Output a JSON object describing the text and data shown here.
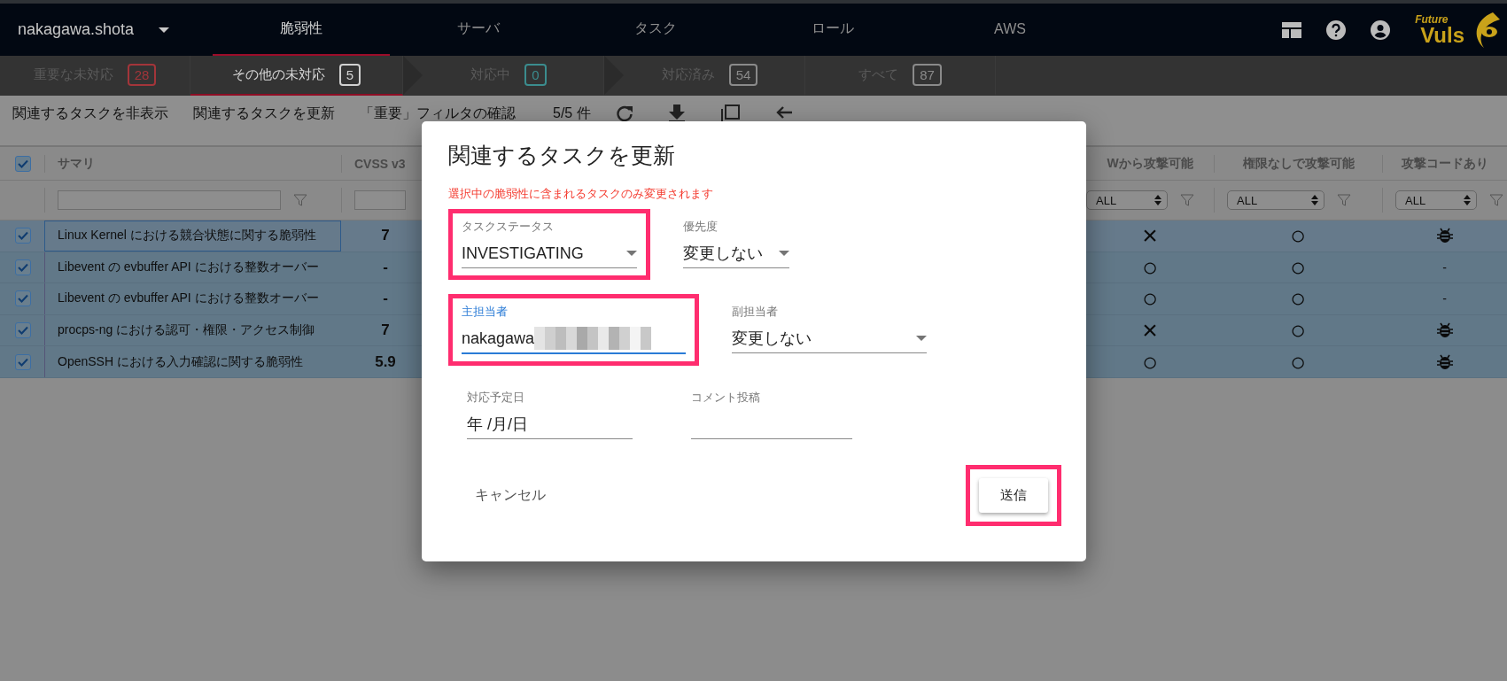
{
  "nav": {
    "user": "nakagawa.shota",
    "tabs": [
      {
        "label": "脆弱性",
        "selected": true
      },
      {
        "label": "サーバ",
        "selected": false
      },
      {
        "label": "タスク",
        "selected": false
      },
      {
        "label": "ロール",
        "selected": false
      },
      {
        "label": "AWS",
        "selected": false
      }
    ],
    "logo": {
      "line_1": "Future",
      "line_2": "Vuls"
    }
  },
  "status_tabs": [
    {
      "label": "重要な未対応",
      "count": "28",
      "color": "#a3353a",
      "selected": false,
      "arrow_after": false
    },
    {
      "label": "その他の未対応",
      "count": "5",
      "color": "#d0d0d0",
      "selected": true,
      "arrow_after": true
    },
    {
      "label": "対応中",
      "count": "0",
      "color": "#3b8c8e",
      "selected": false,
      "arrow_after": true
    },
    {
      "label": "対応済み",
      "count": "54",
      "color": "#8a8a8a",
      "selected": false,
      "arrow_after": false
    },
    {
      "label": "すべて",
      "count": "87",
      "color": "#8a8a8a",
      "selected": false,
      "arrow_after": false
    }
  ],
  "toolbar": {
    "actions": [
      "関連するタスクを非表示",
      "関連するタスクを更新",
      "「重要」フィルタの確認"
    ],
    "count": "5/5 件"
  },
  "table": {
    "header_checked": true,
    "columns": [
      "サマリ",
      "CVSS v3",
      "Wから攻撃可能",
      "権限なしで攻撃可能",
      "攻撃コードあり"
    ],
    "filters": [
      "ALL",
      "ALL",
      "ALL"
    ],
    "rows": [
      {
        "checked": true,
        "focused": true,
        "summary": "Linux Kernel における競合状態に関する脆弱性",
        "cvss": "7",
        "network": "×",
        "no_privilege": "○",
        "exploit": {
          "kind": "bug"
        }
      },
      {
        "checked": true,
        "focused": false,
        "summary": "Libevent の evbuffer API における整数オーバー",
        "cvss": "-",
        "network": "○",
        "no_privilege": "○",
        "exploit": {
          "kind": "text",
          "text": "-"
        }
      },
      {
        "checked": true,
        "focused": false,
        "summary": "Libevent の evbuffer API における整数オーバー",
        "cvss": "-",
        "network": "○",
        "no_privilege": "○",
        "exploit": {
          "kind": "text",
          "text": "-"
        }
      },
      {
        "checked": true,
        "focused": false,
        "summary": "procps-ng における認可・権限・アクセス制御",
        "cvss": "7",
        "network": "×",
        "no_privilege": "○",
        "exploit": {
          "kind": "bug"
        }
      },
      {
        "checked": true,
        "focused": false,
        "summary": "OpenSSH における入力確認に関する脆弱性",
        "cvss": "5.9",
        "network": "○",
        "no_privilege": "○",
        "exploit": {
          "kind": "bug"
        }
      }
    ]
  },
  "dialog": {
    "title": "関連するタスクを更新",
    "notice": "選択中の脆弱性に含まれるタスクのみ変更されます",
    "field_rows": [
      [
        {
          "kind": "select",
          "label": "タスクステータス",
          "value": "INVESTIGATING",
          "highlighted": true,
          "focused": false,
          "redacted": false
        },
        {
          "kind": "select",
          "label": "優先度",
          "value": "変更しない",
          "highlighted": false,
          "focused": false,
          "redacted": false
        }
      ],
      [
        {
          "kind": "text",
          "label": "主担当者",
          "value": "nakagawa",
          "highlighted": true,
          "focused": true,
          "redacted": true
        },
        {
          "kind": "select",
          "label": "副担当者",
          "value": "変更しない",
          "highlighted": false,
          "focused": false,
          "redacted": false
        }
      ],
      [
        {
          "kind": "date",
          "label": "対応予定日",
          "value": "年 /月/日",
          "highlighted": false,
          "focused": false,
          "redacted": false
        },
        {
          "kind": "text",
          "label": "コメント投稿",
          "highlighted": false,
          "focused": false,
          "redacted": false
        }
      ]
    ],
    "cancel": "キャンセル",
    "submit": {
      "label": "送信",
      "highlighted": true
    }
  }
}
